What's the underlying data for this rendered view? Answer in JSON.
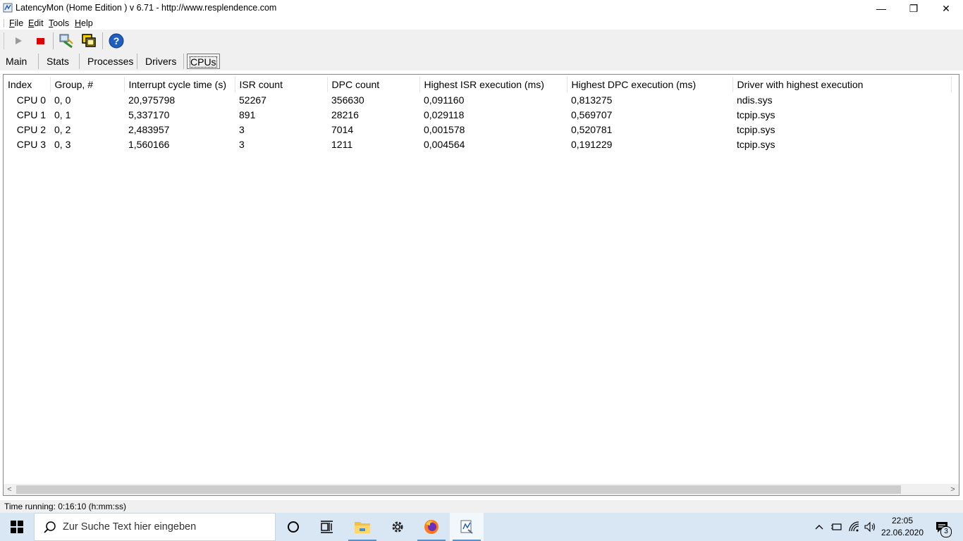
{
  "window": {
    "title": "LatencyMon  (Home Edition )  v 6.71 - http://www.resplendence.com",
    "minimize_glyph": "—",
    "maximize_glyph": "❐",
    "close_glyph": "✕"
  },
  "menu": {
    "items": [
      {
        "key": "F",
        "rest": "ile"
      },
      {
        "key": "E",
        "rest": "dit"
      },
      {
        "key": "T",
        "rest": "ools"
      },
      {
        "key": "H",
        "rest": "elp"
      }
    ]
  },
  "toolbar": {
    "buttons": [
      "play-icon",
      "stop-icon",
      "hardware-icon",
      "cpu-windows-icon",
      "help-icon"
    ],
    "colors": {
      "stop": "#e00000",
      "help": "#1f5fbf"
    }
  },
  "tabs": [
    {
      "label": "Main",
      "active": false
    },
    {
      "label": "Stats",
      "active": false
    },
    {
      "label": "Processes",
      "active": false
    },
    {
      "label": "Drivers",
      "active": false
    },
    {
      "label": "CPUs",
      "active": true
    }
  ],
  "cpu_table": {
    "columns": [
      "Index",
      "Group, #",
      "Interrupt cycle time (s)",
      "ISR count",
      "DPC count",
      "Highest ISR execution (ms)",
      "Highest DPC execution (ms)",
      "Driver with highest execution"
    ],
    "rows": [
      [
        "CPU 0",
        "0, 0",
        "20,975798",
        "52267",
        "356630",
        "0,091160",
        "0,813275",
        "ndis.sys"
      ],
      [
        "CPU 1",
        "0, 1",
        "5,337170",
        "891",
        "28216",
        "0,029118",
        "0,569707",
        "tcpip.sys"
      ],
      [
        "CPU 2",
        "0, 2",
        "2,483957",
        "3",
        "7014",
        "0,001578",
        "0,520781",
        "tcpip.sys"
      ],
      [
        "CPU 3",
        "0, 3",
        "1,560166",
        "3",
        "1211",
        "0,004564",
        "0,191229",
        "tcpip.sys"
      ]
    ]
  },
  "scrollbar": {
    "left_glyph": "<",
    "right_glyph": ">"
  },
  "status": {
    "text": "Time running: 0:16:10  (h:mm:ss)"
  },
  "taskbar": {
    "search_placeholder": "Zur Suche Text hier eingeben",
    "apps": [
      "cortana-icon",
      "task-view-icon",
      "file-explorer-icon",
      "settings-icon",
      "firefox-icon",
      "latencymon-icon"
    ],
    "tray": {
      "chevron": "^"
    },
    "clock": {
      "time": "22:05",
      "date": "22.06.2020"
    },
    "notification_count": "3"
  }
}
